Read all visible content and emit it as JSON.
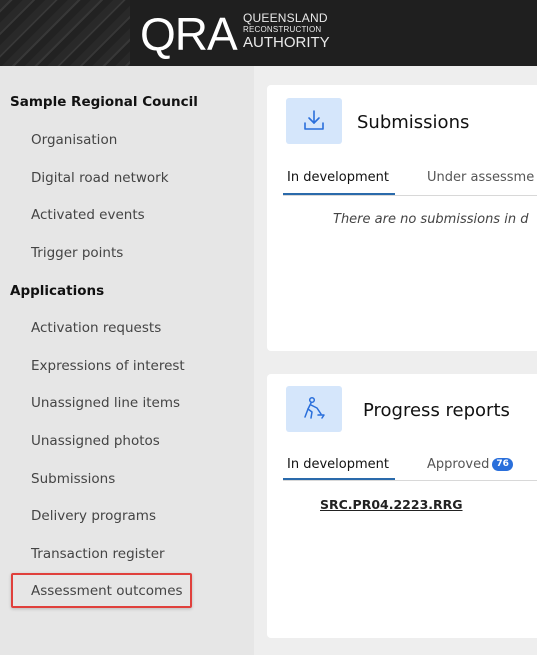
{
  "header": {
    "logo_mark": "QRA",
    "logo_line1": "QUEENSLAND",
    "logo_line2": "RECONSTRUCTION",
    "logo_line3": "AUTHORITY"
  },
  "sidebar": {
    "council_heading": "Sample Regional Council",
    "council_items": [
      {
        "label": "Organisation"
      },
      {
        "label": "Digital road network"
      },
      {
        "label": "Activated events"
      },
      {
        "label": "Trigger points"
      }
    ],
    "applications_heading": "Applications",
    "application_items": [
      {
        "label": "Activation requests"
      },
      {
        "label": "Expressions of interest"
      },
      {
        "label": "Unassigned line items"
      },
      {
        "label": "Unassigned photos"
      },
      {
        "label": "Submissions"
      },
      {
        "label": "Delivery programs"
      },
      {
        "label": "Transaction register"
      },
      {
        "label": "Assessment outcomes"
      }
    ],
    "highlight_color": "#e0403c"
  },
  "submissions_card": {
    "icon": "download-icon",
    "title": "Submissions",
    "tabs": [
      {
        "label": "In development",
        "active": true
      },
      {
        "label": "Under assessme",
        "active": false
      }
    ],
    "empty_message": "There are no submissions in d"
  },
  "progress_card": {
    "icon": "worker-digging-icon",
    "title": "Progress reports",
    "tabs": [
      {
        "label": "In development",
        "active": true
      },
      {
        "label": "Approved",
        "active": false,
        "badge": "76"
      }
    ],
    "report_link": "SRC.PR04.2223.RRG"
  },
  "colors": {
    "accent": "#2a6aab",
    "icon_bg": "#d5e6fb",
    "badge": "#2a6fdb"
  }
}
